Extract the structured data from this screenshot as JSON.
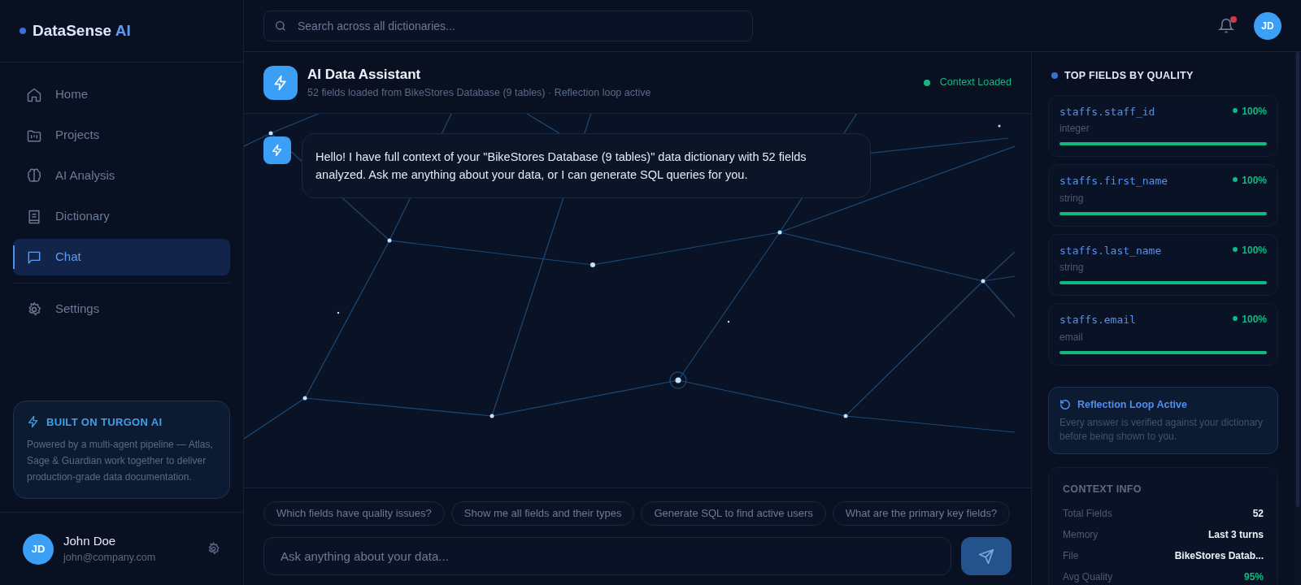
{
  "brand": {
    "name_part1": "DataSense",
    "name_part2": " AI"
  },
  "nav": [
    {
      "label": "Home",
      "selected": false
    },
    {
      "label": "Projects",
      "selected": false
    },
    {
      "label": "AI Analysis",
      "selected": false
    },
    {
      "label": "Dictionary",
      "selected": false
    },
    {
      "label": "Chat",
      "selected": true
    },
    {
      "label": "Settings",
      "selected": false
    }
  ],
  "promo": {
    "title": "BUILT ON TURGON AI",
    "text": "Powered by a multi-agent pipeline — Atlas, Sage & Guardian work together to deliver production-grade data documentation."
  },
  "user": {
    "initials": "JD",
    "name": "John Doe",
    "email": "john@company.com"
  },
  "search": {
    "placeholder": "Search across all dictionaries..."
  },
  "notifications": {
    "unread": true
  },
  "header_avatar": "JD",
  "assistant": {
    "title": "AI Data Assistant",
    "subtitle": "52 fields loaded from BikeStores Database (9 tables) · Reflection loop active",
    "status": "Context Loaded"
  },
  "messages": [
    {
      "text": "Hello! I have full context of your \"BikeStores Database (9 tables)\" data dictionary with 52 fields analyzed. Ask me anything about your data, or I can generate SQL queries for you."
    }
  ],
  "suggestions": [
    "Which fields have quality issues?",
    "Show me all fields and their types",
    "Generate SQL to find active users",
    "What are the primary key fields?"
  ],
  "composer": {
    "placeholder": "Ask anything about your data..."
  },
  "top_fields": {
    "title": "TOP FIELDS BY QUALITY",
    "items": [
      {
        "name": "staffs.staff_id",
        "type": "integer",
        "score": "100%",
        "level": 1
      },
      {
        "name": "staffs.first_name",
        "type": "string",
        "score": "100%",
        "level": 1
      },
      {
        "name": "staffs.last_name",
        "type": "string",
        "score": "100%",
        "level": 1
      },
      {
        "name": "staffs.email",
        "type": "email",
        "score": "100%",
        "level": 1
      }
    ]
  },
  "reflection": {
    "title": "Reflection Loop Active",
    "text": "Every answer is verified against your dictionary before being shown to you."
  },
  "context_info": {
    "title": "CONTEXT INFO",
    "rows": [
      {
        "label": "Total Fields",
        "value": "52",
        "kind": "plain"
      },
      {
        "label": "Memory",
        "value": "Last 3 turns",
        "kind": "plain"
      },
      {
        "label": "File",
        "value": "BikeStores Datab...",
        "kind": "plain"
      },
      {
        "label": "Avg Quality",
        "value": "95%",
        "kind": "good"
      }
    ]
  }
}
